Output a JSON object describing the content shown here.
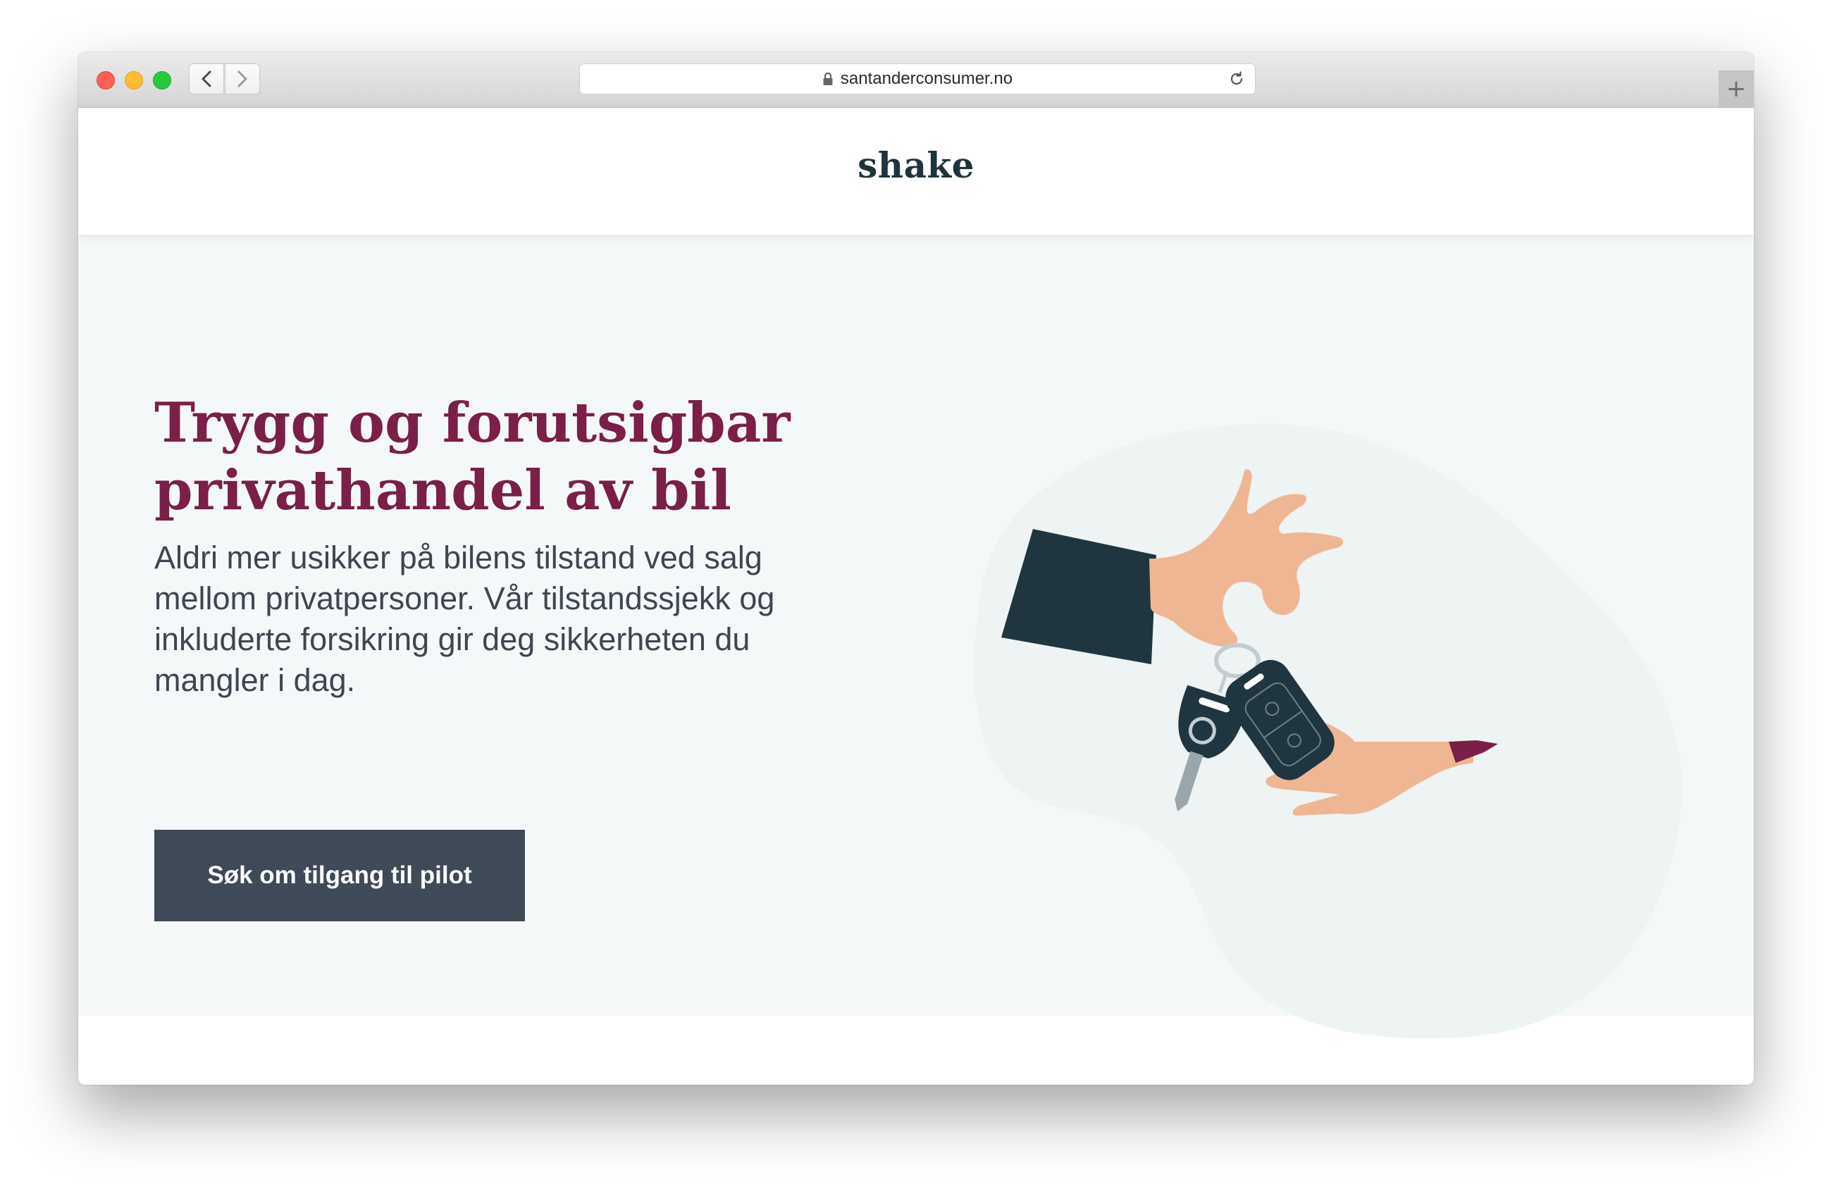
{
  "browser": {
    "url": "santanderconsumer.no",
    "new_tab_label": "+"
  },
  "header": {
    "logo": "shake"
  },
  "hero": {
    "title_line1": "Trygg og forutsigbar",
    "title_line2": "privathandel av bil",
    "description": "Aldri mer usikker på bilens tilstand ved salg mellom privatpersoner. Vår tilstandssjekk og inkluderte forsikring gir deg sikkerheten du mangler i dag.",
    "cta_label": "Søk om tilgang til pilot"
  },
  "colors": {
    "brand_title": "#7a1f48",
    "logo": "#1f333c",
    "button": "#3e4a57",
    "hero_background": "#f5f8f9",
    "skin": "#efb693",
    "sleeve": "#1f3640"
  },
  "icons": {
    "lock": "lock-icon",
    "reload": "reload-icon",
    "back": "chevron-left-icon",
    "forward": "chevron-right-icon"
  }
}
